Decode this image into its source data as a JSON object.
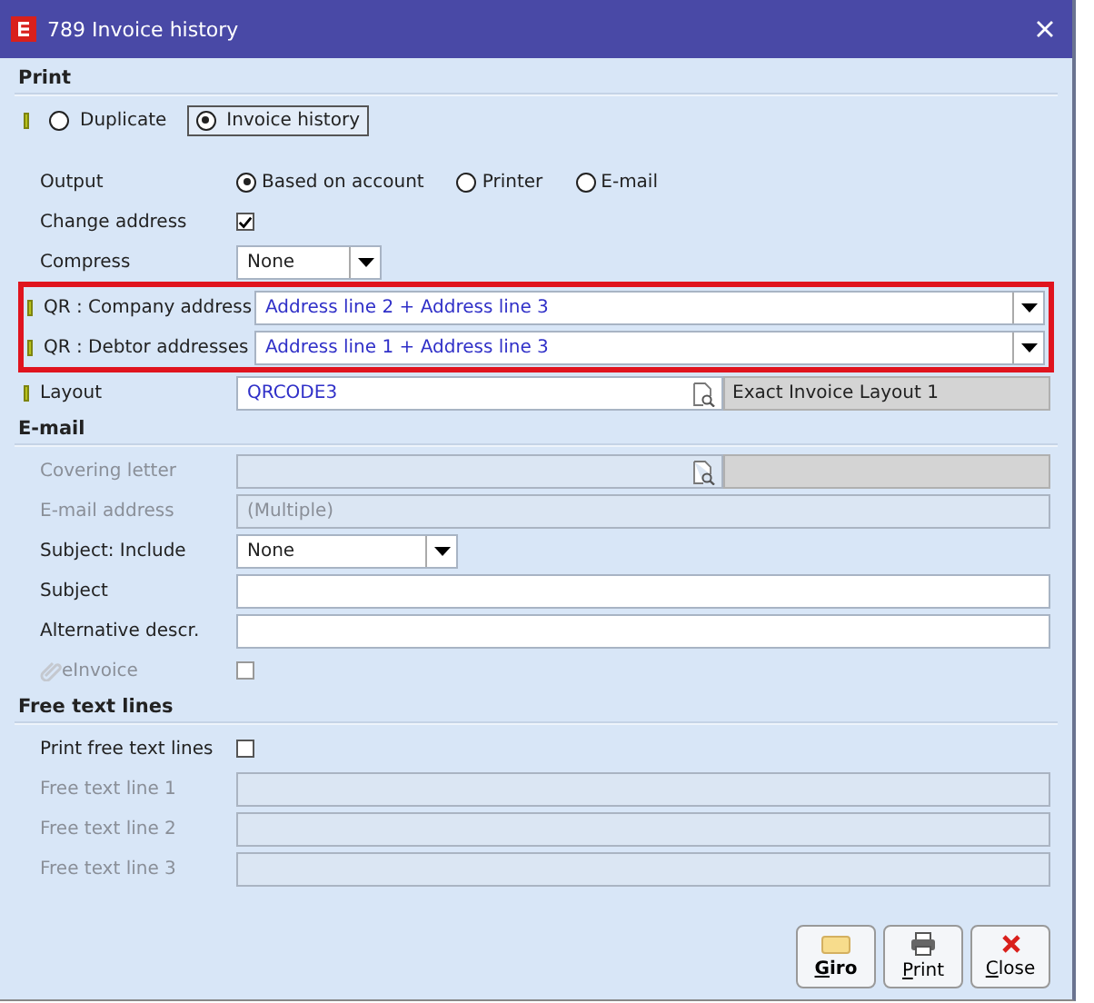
{
  "window": {
    "title": "789 Invoice history"
  },
  "sections": [
    {
      "title": "Print",
      "rows": [
        {
          "kind": "radio_tabs",
          "mandatory": true,
          "options": [
            {
              "label": "Duplicate",
              "selected": false
            },
            {
              "label": "Invoice history",
              "selected": true
            }
          ]
        },
        {
          "kind": "spacer"
        },
        {
          "kind": "radios",
          "label": "Output",
          "options": [
            {
              "label": "Based on account",
              "selected": true
            },
            {
              "label": "Printer",
              "selected": false
            },
            {
              "label": "E-mail",
              "selected": false
            }
          ]
        },
        {
          "kind": "checkbox",
          "label": "Change address",
          "checked": true
        },
        {
          "kind": "dropdown",
          "label": "Compress",
          "value": "None"
        },
        {
          "kind": "highlight",
          "rows": [
            {
              "kind": "combo",
              "label": "QR : Company address",
              "mandatory": true,
              "value": "Address line 2 + Address line 3"
            },
            {
              "kind": "combo",
              "label": "QR : Debtor addresses",
              "mandatory": true,
              "value": "Address line 1 + Address line 3"
            }
          ]
        },
        {
          "kind": "lookup",
          "label": "Layout",
          "mandatory": true,
          "value": "QRCODE3",
          "description": "Exact Invoice Layout 1",
          "disabled": false
        }
      ]
    },
    {
      "title": "E-mail",
      "rows": [
        {
          "kind": "lookup",
          "label": "Covering letter",
          "disabled": true
        },
        {
          "kind": "text",
          "label": "E-mail address",
          "value": "(Multiple)",
          "disabled": true
        },
        {
          "kind": "dropdown",
          "label": "Subject: Include",
          "value": "None",
          "wide": true
        },
        {
          "kind": "text",
          "label": "Subject",
          "disabled": false
        },
        {
          "kind": "text",
          "label": "Alternative descr.",
          "disabled": false
        },
        {
          "kind": "checkbox",
          "label": "eInvoice",
          "checked": false,
          "disabled": true,
          "attachment": true
        }
      ]
    },
    {
      "title": "Free text lines",
      "rows": [
        {
          "kind": "checkbox",
          "label": "Print free text lines",
          "checked": false
        },
        {
          "kind": "text",
          "label": "Free text line 1",
          "disabled": true
        },
        {
          "kind": "text",
          "label": "Free text line 2",
          "disabled": true
        },
        {
          "kind": "text",
          "label": "Free text line 3",
          "disabled": true
        }
      ]
    }
  ],
  "buttons": [
    {
      "label": "Giro",
      "kind": "giro"
    },
    {
      "label": "Print",
      "kind": "print"
    },
    {
      "label": "Close",
      "kind": "close"
    }
  ]
}
